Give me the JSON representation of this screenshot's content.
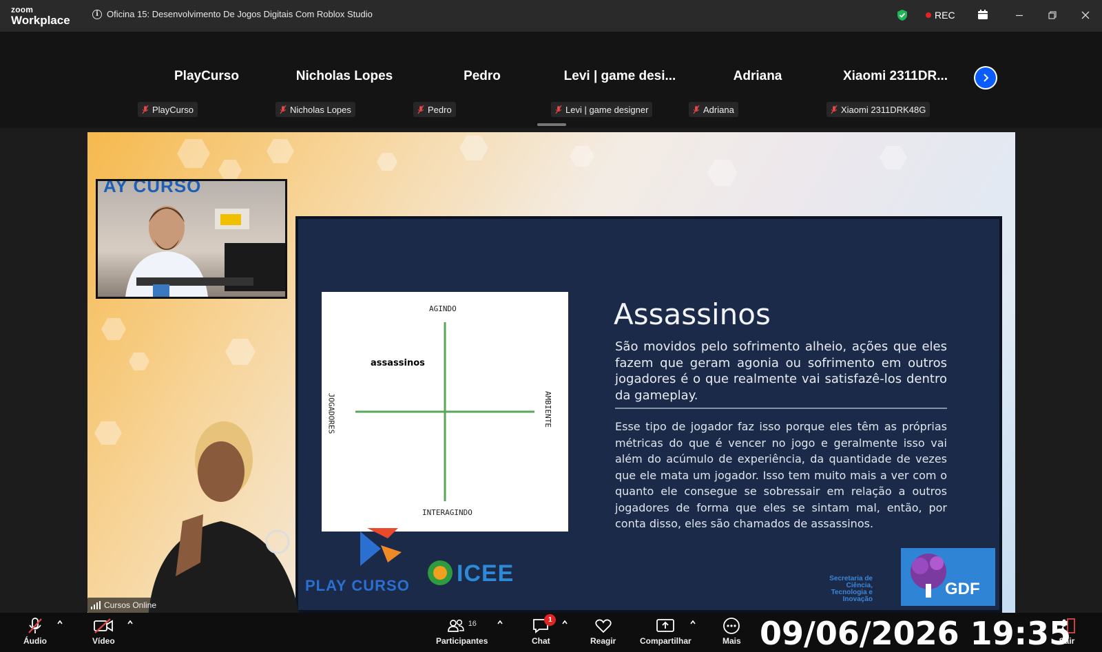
{
  "window": {
    "logo_line1": "zoom",
    "logo_line2": "Workplace",
    "meeting_title": "Oficina 15: Desenvolvimento De Jogos Digitais Com Roblox Studio",
    "rec_label": "REC"
  },
  "participants": [
    {
      "display": "PlayCurso",
      "name": "PlayCurso"
    },
    {
      "display": "Nicholas Lopes",
      "name": "Nicholas Lopes"
    },
    {
      "display": "Pedro",
      "name": "Pedro"
    },
    {
      "display": "Levi | game desi...",
      "name": "Levi | game designer"
    },
    {
      "display": "Adriana",
      "name": "Adriana"
    },
    {
      "display": "Xiaomi  2311DR...",
      "name": "Xiaomi 2311DRK48G"
    }
  ],
  "shared_screen": {
    "presenter_banner": "AY CURSO",
    "slide": {
      "title": "Assassinos",
      "paragraph1": "São movidos pelo sofrimento alheio, ações que eles fazem que geram agonia ou sofrimento em outros jogadores é o que realmente vai satisfazê-los dentro da gameplay.",
      "paragraph2": "Esse tipo de jogador faz isso porque eles têm as próprias métricas do que é vencer no jogo e geralmente isso vai além do acúmulo de experiência, da quantidade de vezes que ele mata um jogador. Isso tem muito mais a ver com o quanto ele consegue se sobressair em relação a outros jogadores de forma que eles se sintam mal, então, por conta disso, eles são chamados de assassinos."
    },
    "diagram": {
      "top": "AGINDO",
      "bottom": "INTERAGINDO",
      "left": "JOGADORES",
      "right": "AMBIENTE",
      "quadrant_label": "assassinos"
    },
    "logos": {
      "playcurso": "PLAY CURSO",
      "icee": "ICEE",
      "gdf_text": "Secretaria de Ciência, Tecnologia e Inovação",
      "gdf": "GDF"
    },
    "connection_label": "Cursos Online"
  },
  "toolbar": {
    "audio": "Áudio",
    "video": "Vídeo",
    "participants": "Participantes",
    "participants_count": "16",
    "chat": "Chat",
    "chat_badge": "1",
    "react": "Reagir",
    "share": "Compartilhar",
    "more": "Mais",
    "leave": "Sair"
  },
  "clock": "09/06/2026 19:35",
  "colors": {
    "accent_blue": "#0b5cff",
    "rec_red": "#e02424",
    "shield_green": "#1fb65a",
    "slide_bg": "#1a2a48"
  }
}
